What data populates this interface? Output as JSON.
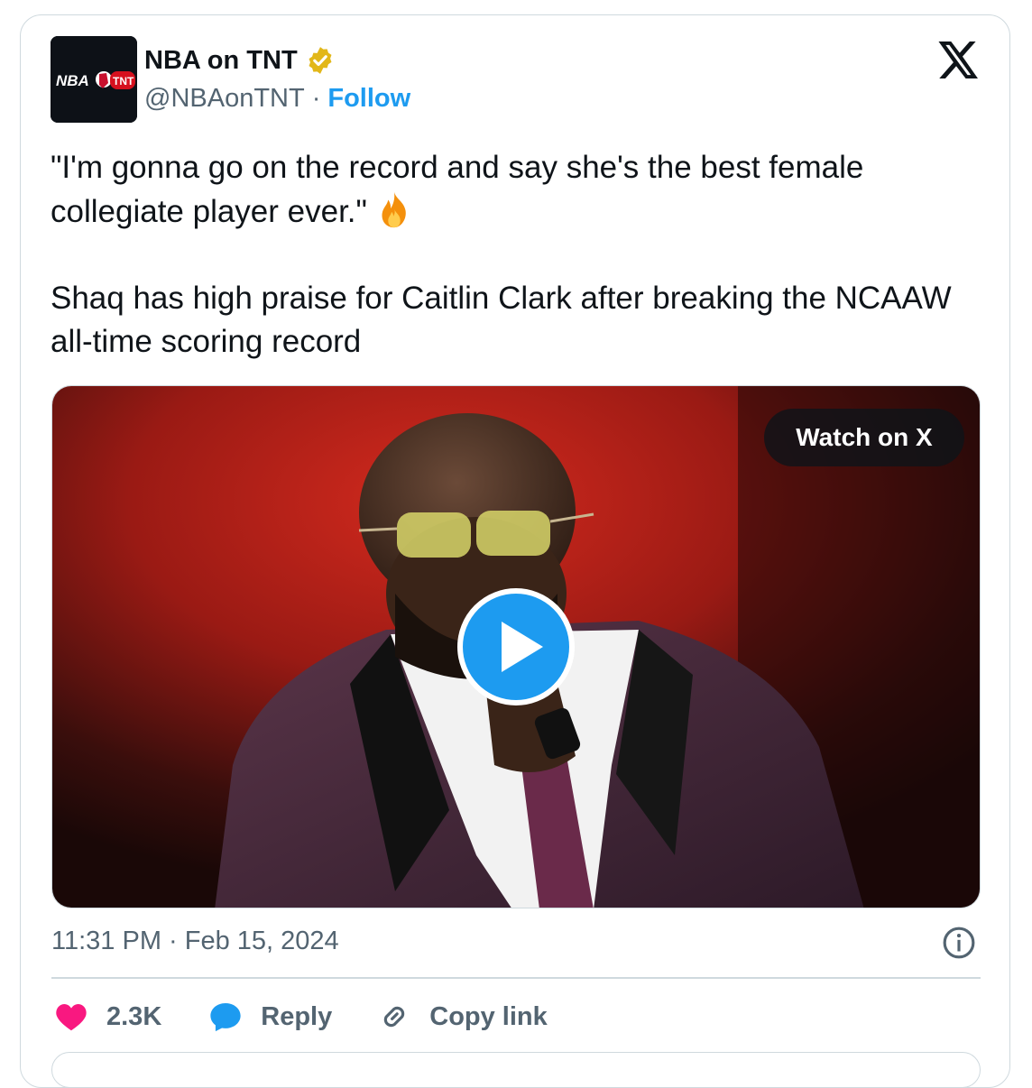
{
  "author": {
    "name": "NBA on TNT",
    "handle": "@NBAonTNT",
    "separator": "·",
    "follow_label": "Follow",
    "avatar_text_left": "NBA",
    "avatar_text_right": "TNT",
    "verified": true
  },
  "tweet": {
    "quote": "\"I'm gonna go on the record and say she's the best female collegiate player ever.\"",
    "body": "Shaq has high praise for Caitlin Clark after breaking the NCAAW all-time scoring record"
  },
  "media": {
    "watch_label": "Watch on X"
  },
  "meta": {
    "timestamp": "11:31 PM · Feb 15, 2024"
  },
  "actions": {
    "likes": "2.3K",
    "reply_label": "Reply",
    "copy_label": "Copy link"
  },
  "colors": {
    "accent": "#1d9bf0",
    "like": "#f91880",
    "verified_gold": "#e2b719",
    "muted": "#536471"
  }
}
